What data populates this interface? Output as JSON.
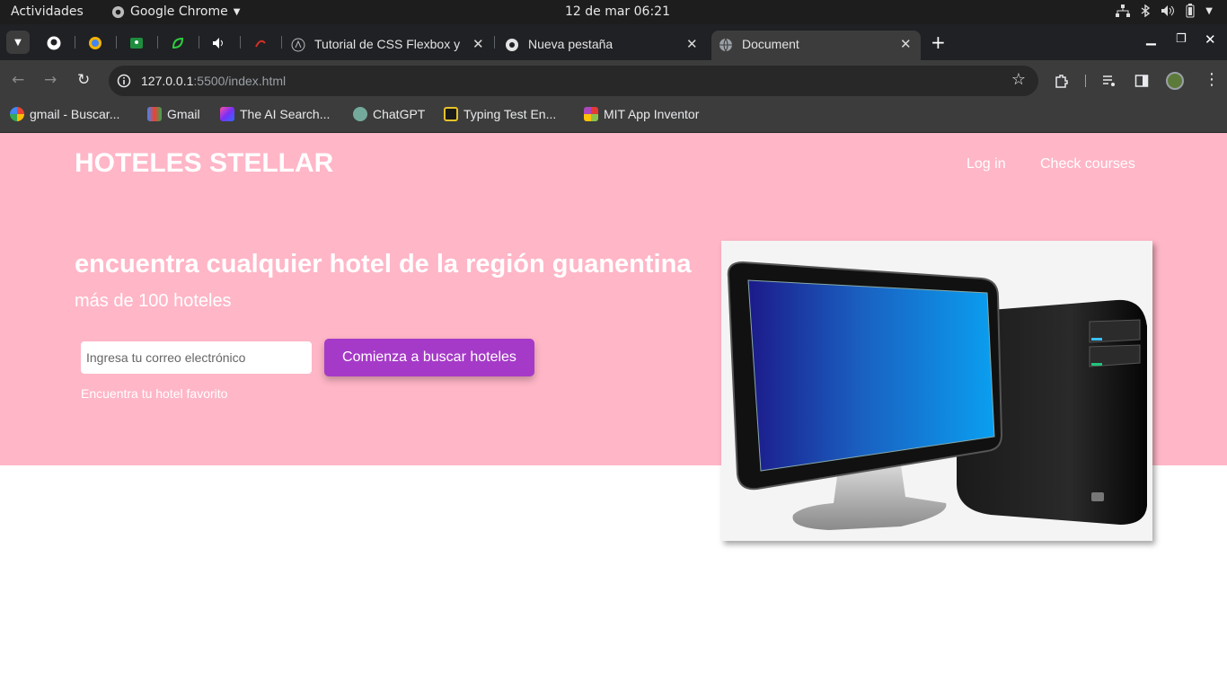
{
  "system_bar": {
    "activities": "Actividades",
    "app_name": "Google Chrome",
    "clock": "12 de mar  06:21"
  },
  "tabs": [
    {
      "title": "Tutorial de CSS Flexbox y",
      "active": false
    },
    {
      "title": "Nueva pestaña",
      "active": false
    },
    {
      "title": "Document",
      "active": true
    }
  ],
  "address_bar": {
    "host": "127.0.0.1",
    "path": ":5500/index.html"
  },
  "bookmarks": [
    {
      "label": "gmail - Buscar...",
      "icon": "google-icon"
    },
    {
      "label": "Gmail",
      "icon": "gmail-icon"
    },
    {
      "label": "The AI Search...",
      "icon": "ai-search-icon"
    },
    {
      "label": "ChatGPT",
      "icon": "chatgpt-icon"
    },
    {
      "label": "Typing Test En...",
      "icon": "typing-test-icon"
    },
    {
      "label": "MIT App Inventor",
      "icon": "app-inventor-icon"
    }
  ],
  "site": {
    "brand": "HOTELES STELLAR",
    "nav": [
      "Log in",
      "Check courses"
    ],
    "headline": "encuentra cualquier hotel de la región guanentina",
    "subheadline": "más de 100 hoteles",
    "email_placeholder": "Ingresa tu correo electrónico",
    "cta_label": "Comienza a buscar hoteles",
    "hint": "Encuentra tu hotel favorito",
    "hero_bg": "#ffb6c7",
    "cta_color": "#a63ac8"
  }
}
